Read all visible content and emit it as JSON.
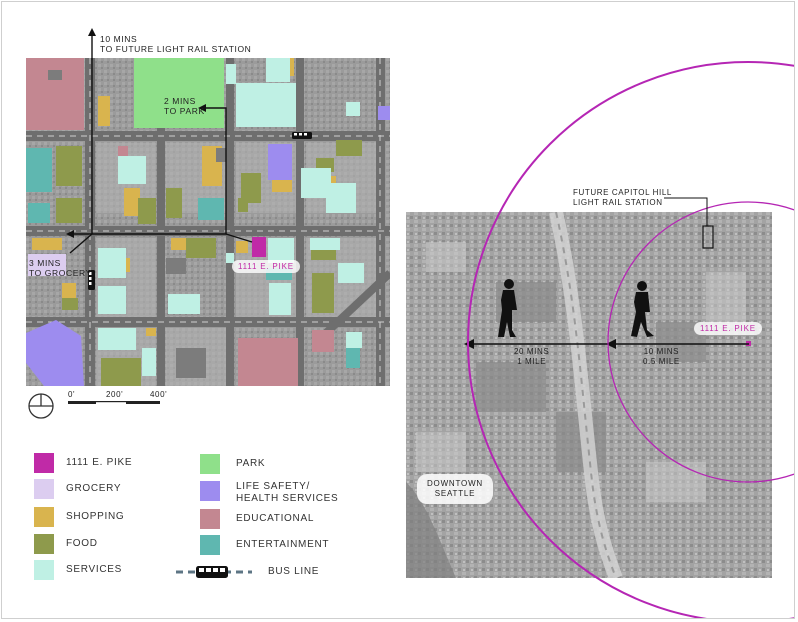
{
  "colors": {
    "site": "#c02aa7",
    "grocery": "#dccdf0",
    "shopping": "#d9b44e",
    "food": "#8e9a4c",
    "services": "#bff0e4",
    "park": "#8fe08a",
    "life_safety": "#9d8cef",
    "educational": "#c38791",
    "entertainment": "#5fb7b0",
    "bus_line": "#5d7584",
    "radius": "#b526b4"
  },
  "site_map": {
    "callouts": {
      "light_rail_line1": "10 MINS",
      "light_rail_line2": "TO FUTURE LIGHT RAIL STATION",
      "park_line1": "2 MINS",
      "park_line2": "TO PARK",
      "grocery_line1": "3 MINS",
      "grocery_line2": "TO GROCERY",
      "site_label": "1111 E. PIKE"
    },
    "scale": {
      "s0": "0'",
      "s1": "200'",
      "s2": "400'"
    },
    "north_arrow_icon": "north-arrow-icon"
  },
  "legend": [
    {
      "label": "1111 E. PIKE",
      "color": "#c02aa7"
    },
    {
      "label": "GROCERY",
      "color": "#dccdf0"
    },
    {
      "label": "SHOPPING",
      "color": "#d9b44e"
    },
    {
      "label": "FOOD",
      "color": "#8e9a4c"
    },
    {
      "label": "SERVICES",
      "color": "#bff0e4"
    },
    {
      "label": "PARK",
      "color": "#8fe08a"
    },
    {
      "label": "LIFE SAFETY/",
      "label2": "HEALTH SERVICES",
      "color": "#9d8cef"
    },
    {
      "label": "EDUCATIONAL",
      "color": "#c38791"
    },
    {
      "label": "ENTERTAINMENT",
      "color": "#5fb7b0"
    },
    {
      "label": "BUS LINE",
      "icon": "bus-icon"
    }
  ],
  "context_map": {
    "station_line1": "FUTURE CAPITOL HILL",
    "station_line2": "LIGHT RAIL STATION",
    "site_label": "1111 E. PIKE",
    "walk_20_line1": "20 MINS",
    "walk_20_line2": "1 MILE",
    "walk_10_line1": "10 MINS",
    "walk_10_line2": "0.5 MILE",
    "downtown_line1": "DOWNTOWN",
    "downtown_line2": "SEATTLE",
    "pedestrian_icon": "pedestrian-icon"
  }
}
